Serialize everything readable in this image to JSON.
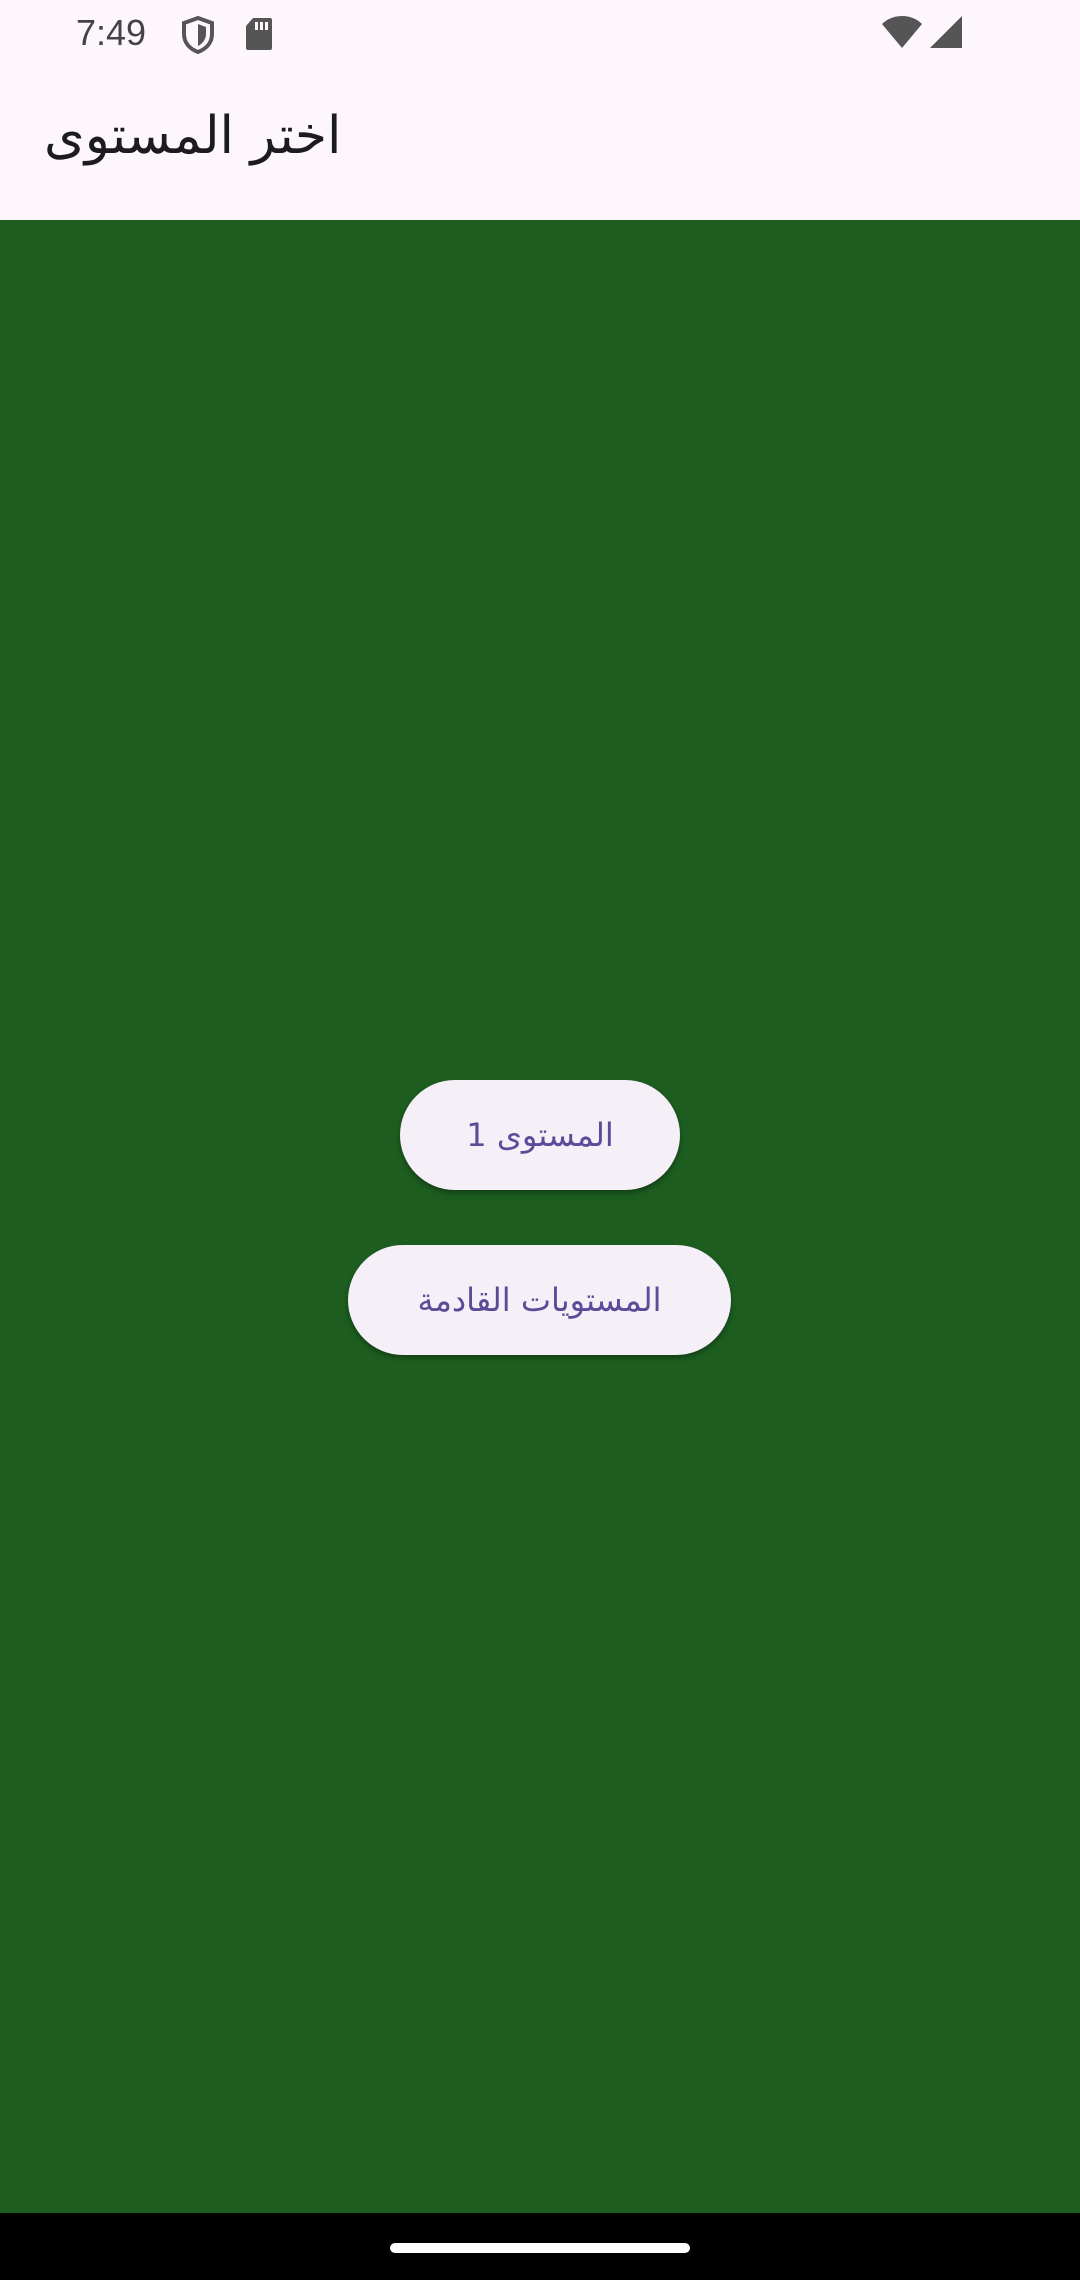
{
  "status_bar": {
    "time": "7:49",
    "icons": [
      "shield-icon",
      "sd-card-icon",
      "wifi-icon",
      "cell-signal-icon"
    ]
  },
  "app_bar": {
    "title": "اختر المستوى"
  },
  "main": {
    "level1_button_label": "المستوى 1",
    "upcoming_levels_button_label": "المستويات القادمة"
  },
  "colors": {
    "background": "#1d5e20",
    "app_bar": "#fdf7fd",
    "button_bg": "#f5eff7",
    "button_text": "#5d4a99",
    "nav_bar": "#000000"
  }
}
